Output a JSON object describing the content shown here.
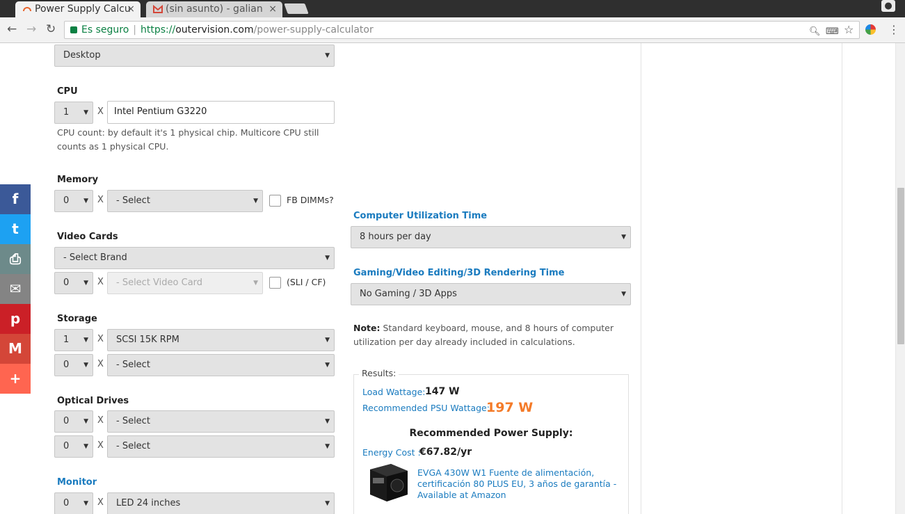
{
  "browser": {
    "tabs": [
      {
        "title": "Power Supply Calcu",
        "active": true
      },
      {
        "title": "(sin asunto) - galian",
        "active": false
      }
    ],
    "secure_label": "Es seguro",
    "url": {
      "proto": "https://",
      "host": "outervision.com",
      "path": "/power-supply-calculator"
    },
    "icons": [
      "back-icon",
      "forward-icon",
      "reload-icon",
      "lock-icon",
      "zoom-icon",
      "translate-icon",
      "star-icon",
      "extension-icon",
      "menu-icon",
      "account-icon"
    ]
  },
  "form": {
    "system_type": {
      "value": "Desktop"
    },
    "cpu": {
      "label": "CPU",
      "count": "1",
      "model": "Intel Pentium G3220",
      "help": "CPU count: by default it's 1 physical chip. Multicore CPU still counts as 1 physical CPU."
    },
    "memory": {
      "label": "Memory",
      "count": "0",
      "type": "- Select",
      "fbdimm_label": "FB DIMMs?"
    },
    "video": {
      "label": "Video Cards",
      "brand": "- Select Brand",
      "count": "0",
      "card": "- Select Video Card",
      "sli_label": "(SLI / CF)"
    },
    "storage": {
      "label": "Storage",
      "rows": [
        {
          "count": "1",
          "type": "SCSI 15K RPM"
        },
        {
          "count": "0",
          "type": "- Select"
        }
      ]
    },
    "optical": {
      "label": "Optical Drives",
      "rows": [
        {
          "count": "0",
          "type": "- Select"
        },
        {
          "count": "0",
          "type": "- Select"
        }
      ]
    },
    "monitor": {
      "label": "Monitor",
      "count": "0",
      "type": "LED 24 inches"
    },
    "x_sign": "X"
  },
  "usage": {
    "utilization_label": "Computer Utilization Time",
    "utilization_value": "8 hours per day",
    "gaming_label": "Gaming/Video Editing/3D Rendering Time",
    "gaming_value": "No Gaming / 3D Apps",
    "note_bold": "Note:",
    "note_text": " Standard keyboard, mouse, and 8 hours of computer utilization per day already included in calculations."
  },
  "results": {
    "legend": "Results:",
    "load_label": "Load Wattage:",
    "load_value": "147 W",
    "psu_label": "Recommended PSU Wattage:",
    "psu_value": "197 W",
    "psu_color": "#f47b29",
    "rec_title": "Recommended Power Supply:",
    "energy_label": "Energy Cost :",
    "energy_value": "€67.82/yr",
    "product_link": "EVGA 430W W1 Fuente de alimentación, certificación 80 PLUS EU, 3 años de garantía - Available at Amazon"
  },
  "share": [
    {
      "icon": "facebook-icon",
      "glyph": "f",
      "color": "#3b5998"
    },
    {
      "icon": "twitter-icon",
      "glyph": "t",
      "color": "#1da1f2"
    },
    {
      "icon": "print-icon",
      "glyph": "⎙",
      "color": "#6d8a8a"
    },
    {
      "icon": "email-icon",
      "glyph": "✉",
      "color": "#848484"
    },
    {
      "icon": "pinterest-icon",
      "glyph": "p",
      "color": "#cb2027"
    },
    {
      "icon": "gmail-icon",
      "glyph": "M",
      "color": "#d44638"
    },
    {
      "icon": "more-icon",
      "glyph": "+",
      "color": "#ff6550"
    }
  ]
}
